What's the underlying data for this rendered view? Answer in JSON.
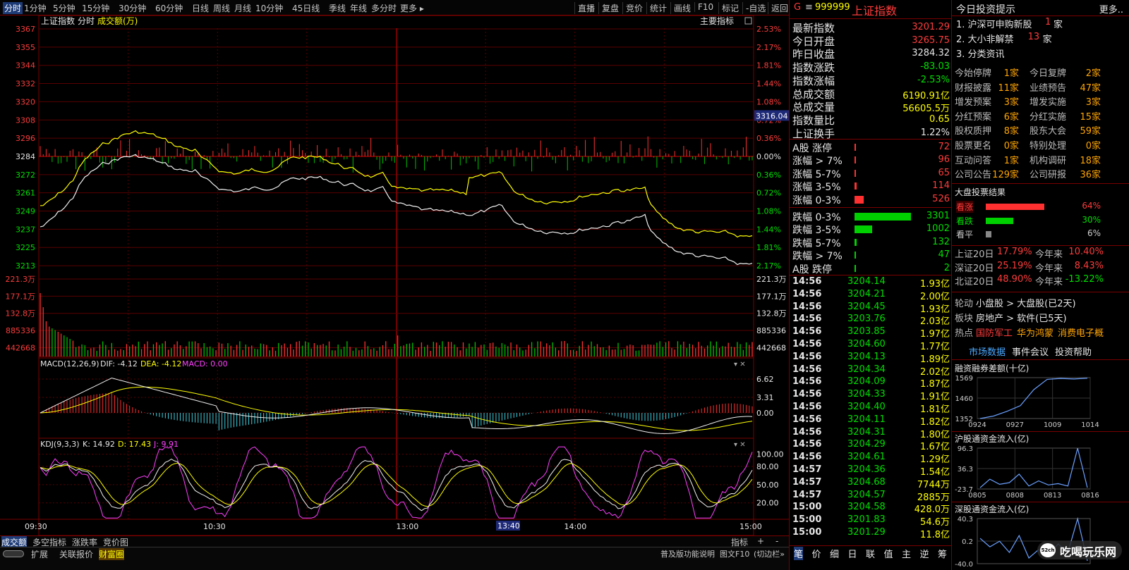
{
  "toolbar": {
    "periods": [
      "分时",
      "1分钟",
      "5分钟",
      "15分钟",
      "30分钟",
      "60分钟",
      "日线",
      "周线",
      "月线",
      "10分钟",
      "45日线",
      "季线",
      "年线",
      "多分时",
      "更多"
    ],
    "buttons": [
      "直播",
      "复盘",
      "竞价",
      "统计",
      "画线",
      "F10",
      "标记",
      "-自选",
      "返回"
    ]
  },
  "chart": {
    "title": "上证指数",
    "mode": "分时",
    "vol_label": "成交额(万)",
    "main_indicator": "主要指标",
    "price_ticks": [
      "3367",
      "3355",
      "3344",
      "3332",
      "3320",
      "3308",
      "3296",
      "3284",
      "3272",
      "3261",
      "3249",
      "3237",
      "3225",
      "3213"
    ],
    "pct_ticks": [
      "2.53%",
      "2.17%",
      "1.81%",
      "1.44%",
      "1.08%",
      "0.72%",
      "0.36%",
      "0.00%",
      "0.36%",
      "0.72%",
      "1.08%",
      "1.44%",
      "1.81%",
      "2.17%"
    ],
    "cur_price": "3316.04",
    "vol_ticks": [
      "221.3万",
      "177.1万",
      "132.8万",
      "885336",
      "442668"
    ],
    "macd_title": "MACD(12,26,9)",
    "macd_dif": "DIF: -4.12",
    "macd_dea": "DEA: -4.12",
    "macd_val": "MACD: 0.00",
    "macd_ticks": [
      "6.62",
      "3.31",
      "0.00"
    ],
    "kdj_title": "KDJ(9,3,3)",
    "kdj_k": "K: 14.92",
    "kdj_d": "D: 17.43",
    "kdj_j": "J: 9.91",
    "kdj_ticks": [
      "100.00",
      "80.00",
      "50.00",
      "20.00"
    ],
    "time_ticks": [
      "09:30",
      "10:30",
      "13:00",
      "14:00",
      "15:00"
    ],
    "cursor_time": "13:40"
  },
  "bottom_tabs": [
    "成交额",
    "多空指标",
    "涨跌率",
    "竞价图"
  ],
  "bottom_right": [
    "指标",
    "+",
    "-"
  ],
  "footer": {
    "items": [
      "扩展",
      "关联报价",
      "财富圈"
    ],
    "right": [
      "普及版功能说明",
      "图文F10",
      "(切边栏»"
    ]
  },
  "quote": {
    "flag": "G",
    "code": "999999",
    "name": "上证指数",
    "rows": [
      [
        "最新指数",
        "3201.29",
        "red"
      ],
      [
        "今日开盘",
        "3265.75",
        "red"
      ],
      [
        "昨日收盘",
        "3284.32",
        "wht"
      ],
      [
        "指数涨跌",
        "-83.03",
        "grn"
      ],
      [
        "指数涨幅",
        "-2.53%",
        "grn"
      ],
      [
        "总成交额",
        "6190.91亿",
        "yel"
      ],
      [
        "总成交量",
        "56605.5万",
        "yel"
      ],
      [
        "指数量比",
        "0.65",
        "yel"
      ],
      [
        "上证换手",
        "1.22%",
        "wht"
      ]
    ]
  },
  "breadth": [
    {
      "label": "A股 涨停",
      "value": "72",
      "dir": "up",
      "frac": 0.02
    },
    {
      "label": "涨幅 > 7%",
      "value": "96",
      "dir": "up",
      "frac": 0.025
    },
    {
      "label": "涨幅 5-7%",
      "value": "65",
      "dir": "up",
      "frac": 0.02
    },
    {
      "label": "涨幅 3-5%",
      "value": "114",
      "dir": "up",
      "frac": 0.04
    },
    {
      "label": "涨幅 0-3%",
      "value": "526",
      "dir": "up",
      "frac": 0.16
    },
    {
      "label": "跌幅 0-3%",
      "value": "3301",
      "dir": "dn",
      "frac": 1.0
    },
    {
      "label": "跌幅 3-5%",
      "value": "1002",
      "dir": "dn",
      "frac": 0.31
    },
    {
      "label": "跌幅 5-7%",
      "value": "132",
      "dir": "dn",
      "frac": 0.04
    },
    {
      "label": "跌幅 > 7%",
      "value": "47",
      "dir": "dn",
      "frac": 0.015
    },
    {
      "label": "A股 跌停",
      "value": "2",
      "dir": "dn",
      "frac": 0.005
    }
  ],
  "ticks": [
    [
      "14:56",
      "3204.14",
      "1.93亿"
    ],
    [
      "14:56",
      "3204.21",
      "2.00亿"
    ],
    [
      "14:56",
      "3204.45",
      "1.93亿"
    ],
    [
      "14:56",
      "3203.76",
      "2.03亿"
    ],
    [
      "14:56",
      "3203.85",
      "1.97亿"
    ],
    [
      "14:56",
      "3204.60",
      "1.77亿"
    ],
    [
      "14:56",
      "3204.13",
      "1.89亿"
    ],
    [
      "14:56",
      "3204.34",
      "2.02亿"
    ],
    [
      "14:56",
      "3204.09",
      "1.87亿"
    ],
    [
      "14:56",
      "3204.33",
      "1.91亿"
    ],
    [
      "14:56",
      "3204.40",
      "1.81亿"
    ],
    [
      "14:56",
      "3204.11",
      "1.82亿"
    ],
    [
      "14:56",
      "3204.31",
      "1.80亿"
    ],
    [
      "14:56",
      "3204.29",
      "1.67亿"
    ],
    [
      "14:56",
      "3204.61",
      "1.29亿"
    ],
    [
      "14:57",
      "3204.36",
      "1.54亿"
    ],
    [
      "14:57",
      "3204.68",
      "7744万"
    ],
    [
      "14:57",
      "3204.57",
      "2885万"
    ],
    [
      "15:00",
      "3204.58",
      "428.0万"
    ],
    [
      "15:00",
      "3201.83",
      "54.6万"
    ],
    [
      "15:00",
      "3201.29",
      "11.8亿"
    ]
  ],
  "ticks_tabs": [
    "笔",
    "价",
    "细",
    "日",
    "联",
    "值",
    "主",
    "逆",
    "筹"
  ],
  "side": {
    "title": "今日投资提示",
    "more": "更多..",
    "tips": [
      [
        "1. 沪深可申购新股",
        "1",
        "家"
      ],
      [
        "2. 大小非解禁",
        "13",
        "家"
      ],
      [
        "3. 分类资讯",
        "",
        ""
      ]
    ],
    "stats": [
      [
        "今始停牌",
        "1家",
        "今日复牌",
        "2家"
      ],
      [
        "财报披露",
        "11家",
        "业绩预告",
        "47家"
      ],
      [
        "增发预案",
        "3家",
        "增发实施",
        "3家"
      ],
      [
        "分红预案",
        "6家",
        "分红实施",
        "15家"
      ],
      [
        "股权质押",
        "8家",
        "股东大会",
        "59家"
      ],
      [
        "股票更名",
        "0家",
        "特别处理",
        "0家"
      ],
      [
        "互动问答",
        "1家",
        "机构调研",
        "18家"
      ],
      [
        "公司公告",
        "129家",
        "公司研报",
        "36家"
      ]
    ],
    "vote_title": "大盘投票结果",
    "votes": [
      [
        "看涨",
        "64%",
        0.64
      ],
      [
        "看跌",
        "30%",
        0.3
      ],
      [
        "看平",
        "6%",
        0.06
      ]
    ],
    "perf": [
      [
        "上证20日",
        "17.79%",
        "今年来",
        "10.40%"
      ],
      [
        "深证20日",
        "25.19%",
        "今年来",
        "8.43%"
      ],
      [
        "北证20日",
        "48.90%",
        "今年来",
        "-13.22%"
      ]
    ],
    "rotation": [
      [
        "轮动",
        "小盘股 > 大盘股(已2天)"
      ],
      [
        "板块",
        "房地产 > 软件(已5天)"
      ],
      [
        "热点",
        "国防军工",
        "华为鸿蒙",
        "消费电子概"
      ]
    ],
    "links": [
      "市场数据",
      "事件会议",
      "投资帮助"
    ],
    "mini1": {
      "title": "融资融券差额(十亿)",
      "y": [
        "1569",
        "1460",
        "1352"
      ],
      "x": [
        "0924",
        "0927",
        "1009",
        "1014"
      ],
      "values": [
        1352,
        1365,
        1390,
        1420,
        1505,
        1560,
        1565,
        1562,
        1566
      ]
    },
    "mini2": {
      "title": "沪股通资金流入(亿)",
      "y": [
        "96.3",
        "36.3",
        "-23.7"
      ],
      "x": [
        "0805",
        "0808",
        "0813",
        "0816"
      ],
      "values": [
        -20,
        5,
        -10,
        -5,
        20,
        -15,
        0,
        -12,
        -8,
        -15,
        96,
        -20
      ]
    },
    "mini3": {
      "title": "深股通资金流入(亿)",
      "y": [
        "40.3",
        "0.2",
        "-40.0"
      ],
      "x": [],
      "values": [
        5,
        -10,
        0,
        -20,
        10,
        -30,
        -15,
        -25,
        -5,
        -20,
        40,
        -35
      ]
    }
  },
  "watermark": "吃喝玩乐网"
}
